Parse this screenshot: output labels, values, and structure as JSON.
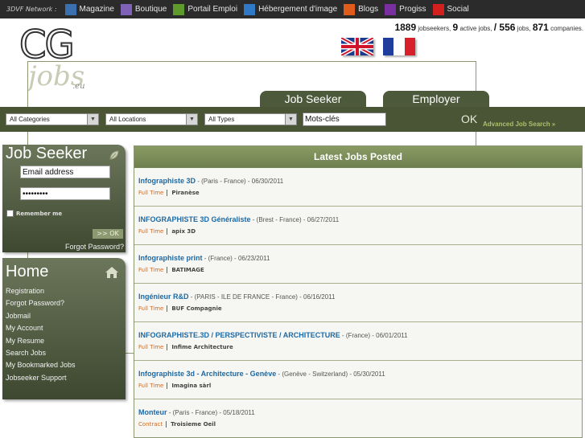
{
  "network": {
    "label": "3DVF Network :",
    "items": [
      {
        "icon": "mag",
        "label": "Magazine",
        "color": "#3a6fb0"
      },
      {
        "icon": "shop",
        "label": "Boutique",
        "color": "#7f62b8"
      },
      {
        "icon": "job",
        "label": "Portail Emploi",
        "color": "#5f9a2c"
      },
      {
        "icon": "up",
        "label": "Hébergement d'image",
        "color": "#2f79c7"
      },
      {
        "icon": "blog",
        "label": "Blogs",
        "color": "#e05c1a"
      },
      {
        "icon": "pr",
        "label": "Progiss",
        "color": "#7a2fa0"
      },
      {
        "icon": "soc",
        "label": "Social",
        "color": "#d41f1f"
      }
    ]
  },
  "logo": {
    "cg": "CG",
    "jobs": "jobs",
    "eu": ".eu"
  },
  "stats": {
    "jobseekers_count": "1889",
    "jobseekers_label": "jobseekers,",
    "active_jobs_count": "9",
    "active_jobs_label": "active jobs,",
    "jobs_count": "/ 556",
    "jobs_label": "jobs,",
    "companies_count": "871",
    "companies_label": "companies."
  },
  "tabs": {
    "seeker": "Job Seeker",
    "employer": "Employer"
  },
  "search": {
    "category": "All Categories",
    "location": "All Locations",
    "type": "All Types",
    "keywords": "Mots-clés",
    "ok": "OK",
    "advanced": "Advanced Job Search »"
  },
  "login": {
    "title": "Job Seeker",
    "email_placeholder": "Email address",
    "password_value": "•••••••••",
    "remember": "Remember me",
    "ok": ">> OK",
    "forgot": "Forgot Password?"
  },
  "home": {
    "title": "Home",
    "links": [
      "Registration",
      "Forgot Password?",
      "Jobmail",
      "My Account",
      "My Resume",
      "Search Jobs",
      "My Bookmarked Jobs",
      "Jobseeker Support"
    ]
  },
  "latest": {
    "title": "Latest Jobs Posted",
    "jobs": [
      {
        "title": "Infographiste 3D",
        "meta": " - (Paris - France) - 06/30/2011",
        "type": "Full Time",
        "company": "Piranèse"
      },
      {
        "title": "INFOGRAPHISTE 3D Généraliste",
        "meta": " - (Brest - France) - 06/27/2011",
        "type": "Full Time",
        "company": "apix 3D"
      },
      {
        "title": "Infographiste print",
        "meta": " - (France) - 06/23/2011",
        "type": "Full Time",
        "company": "BATIMAGE"
      },
      {
        "title": "Ingénieur R&D",
        "meta": " - (PARIS - ILE DE FRANCE - France) - 06/16/2011",
        "type": "Full Time",
        "company": "BUF Compagnie"
      },
      {
        "title": "INFOGRAPHISTE.3D / PERSPECTIVISTE / ARCHITECTURE",
        "meta": " - (France) - 06/01/2011",
        "type": "Full Time",
        "company": "Infime Architecture"
      },
      {
        "title": "Infographiste 3d - Architecture - Genève",
        "meta": " - (Genève - Switzerland) - 05/30/2011",
        "type": "Full Time",
        "company": "Imagina sàrl"
      },
      {
        "title": "Monteur",
        "meta": " - (Paris - France) - 05/18/2011",
        "type": "Contract",
        "company": "Troisieme Oeil"
      }
    ]
  },
  "colors": {
    "brand_green": "#4a5535",
    "link_blue": "#1c6aa6",
    "job_type_orange": "#d2691e"
  }
}
